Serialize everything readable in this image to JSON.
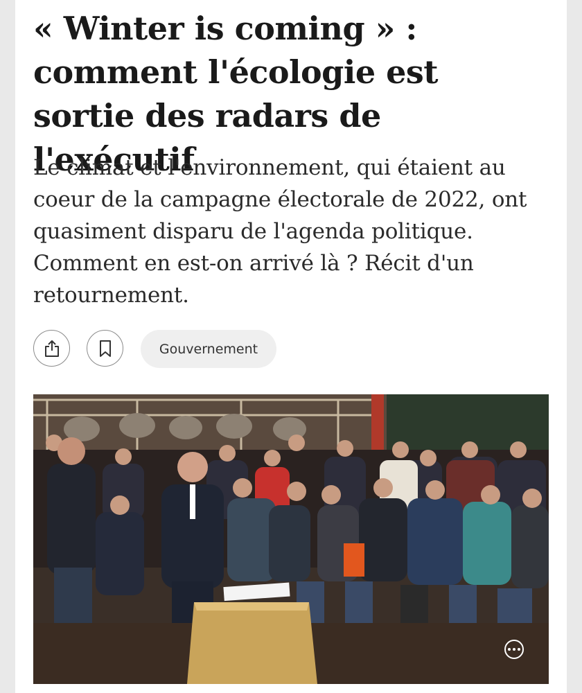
{
  "article": {
    "title": "« Winter is coming » : comment l'écologie est sortie des radars de l'exécutif",
    "subtitle": "Le climat et l'environnement, qui étaient au coeur de la campagne électorale de 2022, ont quasiment disparu de l'agenda politique. Comment en est-on arrivé là ? Récit d'un retournement."
  },
  "actions": {
    "share_icon": "share-icon",
    "bookmark_icon": "bookmark-icon",
    "tag_label": "Gouvernement"
  },
  "photo": {
    "icon": "more-options-icon"
  },
  "colors": {
    "text": "#1a1a1a",
    "tag_bg": "#efefef",
    "border": "#8a8a8a"
  }
}
